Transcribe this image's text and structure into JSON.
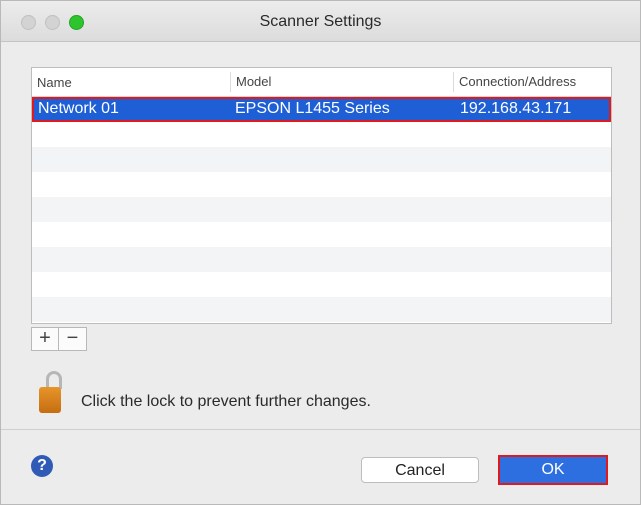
{
  "window": {
    "title": "Scanner Settings"
  },
  "table": {
    "headers": {
      "name": "Name",
      "model": "Model",
      "address": "Connection/Address"
    },
    "rows": [
      {
        "name": "Network 01",
        "model": "EPSON L1455 Series",
        "address": "192.168.43.171"
      }
    ]
  },
  "controls": {
    "add_label": "+",
    "remove_label": "−"
  },
  "lock": {
    "text": "Click the lock to prevent further changes."
  },
  "footer": {
    "help_label": "?",
    "cancel_label": "Cancel",
    "ok_label": "OK"
  },
  "colors": {
    "selection": "#1f5fd6",
    "highlight_outline": "#e0191f",
    "ok_button": "#2d6fe0"
  }
}
